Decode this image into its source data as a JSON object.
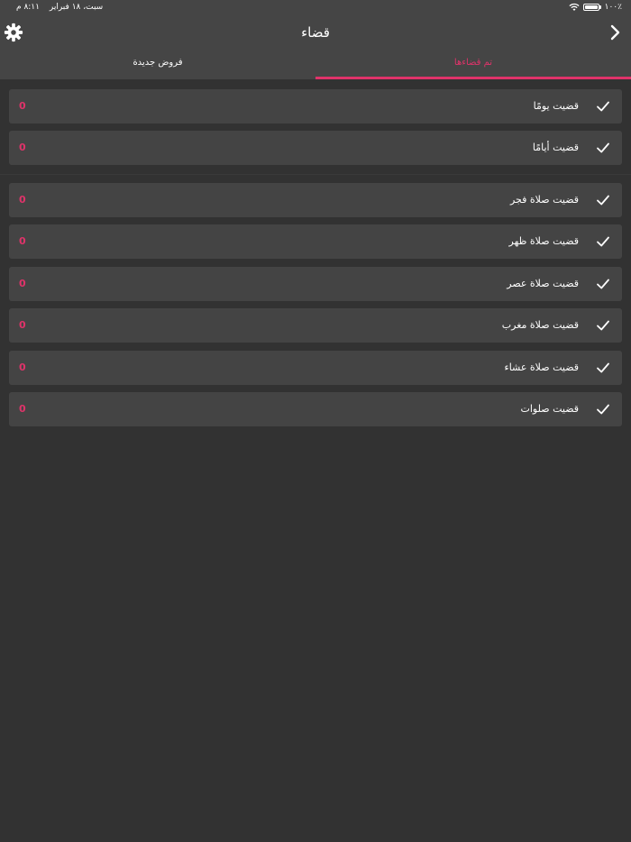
{
  "status_bar": {
    "time": "٨:١١ م",
    "date": "سبت، ١٨ فبراير",
    "battery": "٪١٠٠"
  },
  "header": {
    "title": "قضاء"
  },
  "tabs": [
    {
      "label": "تم قضاءها",
      "active": true
    },
    {
      "label": "فروض جديدة",
      "active": false
    }
  ],
  "accent_color": "#e0336a",
  "days_group": [
    {
      "label": "قضيت يومًا",
      "count": "0"
    },
    {
      "label": "قضيت أيامًا",
      "count": "0"
    }
  ],
  "prayers_group": [
    {
      "label": "قضيت صلاة فجر",
      "count": "0"
    },
    {
      "label": "قضيت صلاة ظهر",
      "count": "0"
    },
    {
      "label": "قضيت صلاة عصر",
      "count": "0"
    },
    {
      "label": "قضيت صلاة مغرب",
      "count": "0"
    },
    {
      "label": "قضيت صلاة عشاء",
      "count": "0"
    },
    {
      "label": "قضيت صلوات",
      "count": "0"
    }
  ]
}
